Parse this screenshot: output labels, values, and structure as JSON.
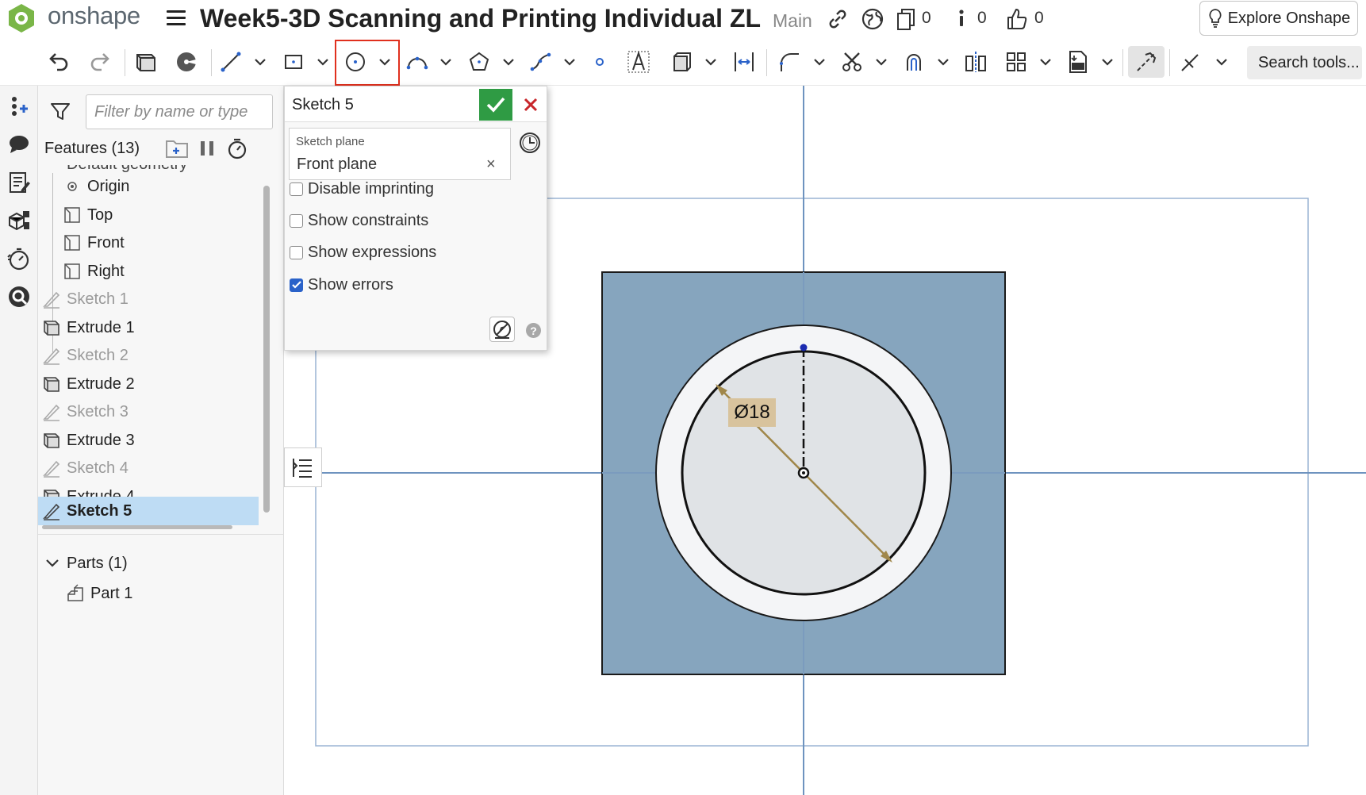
{
  "header": {
    "brand": "onshape",
    "document_title": "Week5-3D Scanning and Printing Individual ZL",
    "branch": "Main",
    "counters": [
      {
        "icon": "versions-icon",
        "count": "0"
      },
      {
        "icon": "info-icon",
        "count": "0"
      },
      {
        "icon": "like-icon",
        "count": "0"
      }
    ],
    "explore_label": "Explore Onshape"
  },
  "toolbar": {
    "search_label": "Search tools...",
    "highlighted_tool": "circle-tool",
    "accent_color": "#e0301e"
  },
  "feature_panel": {
    "filter_placeholder": "Filter by name or type",
    "title": "Features (13)",
    "cut_off_item": "Default geometry",
    "items": [
      {
        "label": "Origin",
        "icon": "origin-icon",
        "state": "normal"
      },
      {
        "label": "Top",
        "icon": "plane-icon",
        "state": "normal"
      },
      {
        "label": "Front",
        "icon": "plane-icon",
        "state": "normal"
      },
      {
        "label": "Right",
        "icon": "plane-icon",
        "state": "normal"
      },
      {
        "label": "Sketch 1",
        "icon": "sketch-icon",
        "state": "dim"
      },
      {
        "label": "Extrude 1",
        "icon": "extrude-icon",
        "state": "normal"
      },
      {
        "label": "Sketch 2",
        "icon": "sketch-icon",
        "state": "dim"
      },
      {
        "label": "Extrude 2",
        "icon": "extrude-icon",
        "state": "normal"
      },
      {
        "label": "Sketch 3",
        "icon": "sketch-icon",
        "state": "dim"
      },
      {
        "label": "Extrude 3",
        "icon": "extrude-icon",
        "state": "normal"
      },
      {
        "label": "Sketch 4",
        "icon": "sketch-icon",
        "state": "dim"
      },
      {
        "label": "Extrude 4",
        "icon": "extrude-icon",
        "state": "normal"
      },
      {
        "label": "Sketch 5",
        "icon": "sketch-icon",
        "state": "selected"
      }
    ],
    "parts_header": "Parts (1)",
    "parts": [
      "Part 1"
    ],
    "selected_color": "#bedcf4"
  },
  "sketch_dialog": {
    "title": "Sketch 5",
    "plane_label": "Sketch plane",
    "plane_value": "Front plane",
    "options": [
      {
        "label": "Disable imprinting",
        "checked": false
      },
      {
        "label": "Show constraints",
        "checked": false
      },
      {
        "label": "Show expressions",
        "checked": false
      },
      {
        "label": "Show errors",
        "checked": true
      }
    ],
    "ok_color": "#2f9b44",
    "cancel_color": "#c8262b"
  },
  "viewport": {
    "dimension_label": "Ø18",
    "part_face_color": "#86a5be",
    "dimension_color": "#a0874a",
    "axis_color": "#6e93bf"
  }
}
